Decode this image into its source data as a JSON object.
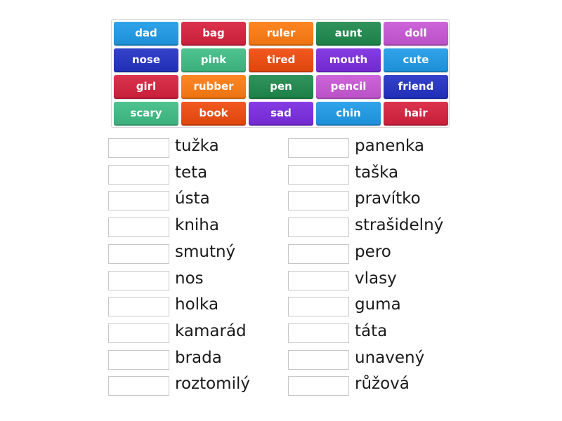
{
  "word_bank": [
    {
      "label": "dad",
      "color": "#1f9be8"
    },
    {
      "label": "bag",
      "color": "#d8213f"
    },
    {
      "label": "ruler",
      "color": "#ff7c12"
    },
    {
      "label": "aunt",
      "color": "#1e8a4d"
    },
    {
      "label": "doll",
      "color": "#c957d6"
    },
    {
      "label": "nose",
      "color": "#2332c5"
    },
    {
      "label": "pink",
      "color": "#3fbe86"
    },
    {
      "label": "tired",
      "color": "#f04b0e"
    },
    {
      "label": "mouth",
      "color": "#7b2ce0"
    },
    {
      "label": "cute",
      "color": "#1f9be8"
    },
    {
      "label": "girl",
      "color": "#d8213f"
    },
    {
      "label": "rubber",
      "color": "#ff7c12"
    },
    {
      "label": "pen",
      "color": "#1e8a4d"
    },
    {
      "label": "pencil",
      "color": "#c957d6"
    },
    {
      "label": "friend",
      "color": "#2332c5"
    },
    {
      "label": "scary",
      "color": "#3fbe86"
    },
    {
      "label": "book",
      "color": "#f04b0e"
    },
    {
      "label": "sad",
      "color": "#7b2ce0"
    },
    {
      "label": "chin",
      "color": "#1f9be8"
    },
    {
      "label": "hair",
      "color": "#d8213f"
    }
  ],
  "targets_left": [
    {
      "word": "tužka",
      "answer": ""
    },
    {
      "word": "teta",
      "answer": ""
    },
    {
      "word": "ústa",
      "answer": ""
    },
    {
      "word": "kniha",
      "answer": ""
    },
    {
      "word": "smutný",
      "answer": ""
    },
    {
      "word": "nos",
      "answer": ""
    },
    {
      "word": "holka",
      "answer": ""
    },
    {
      "word": "kamarád",
      "answer": ""
    },
    {
      "word": "brada",
      "answer": ""
    },
    {
      "word": "roztomilý",
      "answer": ""
    }
  ],
  "targets_right": [
    {
      "word": "panenka",
      "answer": ""
    },
    {
      "word": "taška",
      "answer": ""
    },
    {
      "word": "pravítko",
      "answer": ""
    },
    {
      "word": "strašidelný",
      "answer": ""
    },
    {
      "word": "pero",
      "answer": ""
    },
    {
      "word": "vlasy",
      "answer": ""
    },
    {
      "word": "guma",
      "answer": ""
    },
    {
      "word": "táta",
      "answer": ""
    },
    {
      "word": "unavený",
      "answer": ""
    },
    {
      "word": "růžová",
      "answer": ""
    }
  ]
}
